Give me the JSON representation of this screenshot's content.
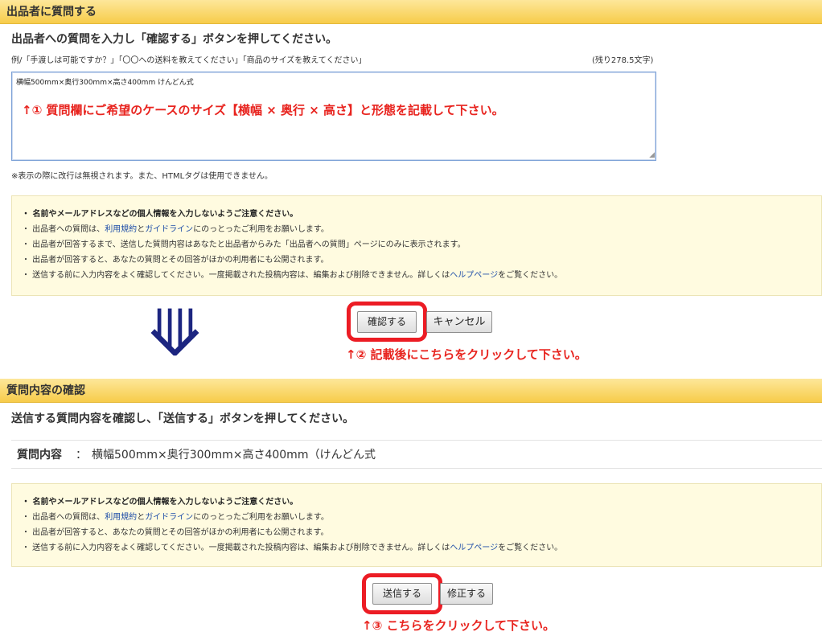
{
  "section1": {
    "header": "出品者に質問する",
    "instruction": "出品者への質問を入力し「確認する」ボタンを押してください。",
    "example": "例/「手渡しは可能ですか？」「〇〇への送料を教えてください」「商品のサイズを教えてください」",
    "remaining": "(残り278.5文字)",
    "textarea_value": "横幅500mm×奥行300mm×高さ400mm  けんどん式",
    "annotation1": "↑① 質問欄にご希望のケースのサイズ【横幅 × 奥行 × 高さ】と形態を記載して下さい。",
    "note": "※表示の際に改行は無視されます。また、HTMLタグは使用できません。",
    "notice": {
      "l1": "・ 名前やメールアドレスなどの個人情報を入力しないようご注意ください。",
      "l2a": "・ 出品者への質問は、",
      "l2_link1": "利用規約",
      "l2b": "と",
      "l2_link2": "ガイドライン",
      "l2c": "にのっとったご利用をお願いします。",
      "l3": "・ 出品者が回答するまで、送信した質問内容はあなたと出品者からみた「出品者への質問」ページにのみに表示されます。",
      "l4": "・ 出品者が回答すると、あなたの質問とその回答がほかの利用者にも公開されます。",
      "l5a": "・ 送信する前に入力内容をよく確認してください。一度掲載された投稿内容は、編集および削除できません。詳しくは",
      "l5_link": "ヘルプページ",
      "l5b": "をご覧ください。"
    },
    "confirm_button": "確認する",
    "cancel_button": "キャンセル",
    "annotation2": "↑② 記載後にこちらをクリックして下さい。"
  },
  "arrow_glyph": "⟱",
  "section2": {
    "header": "質問内容の確認",
    "instruction": "送信する質問内容を確認し、「送信する」ボタンを押してください。",
    "question_label": "質問内容",
    "question_sep": "：",
    "question_value": "横幅500mm×奥行300mm×高さ400mm（けんどん式",
    "notice": {
      "l1": "・ 名前やメールアドレスなどの個人情報を入力しないようご注意ください。",
      "l2a": "・ 出品者への質問は、",
      "l2_link1": "利用規約",
      "l2b": "と",
      "l2_link2": "ガイドライン",
      "l2c": "にのっとったご利用をお願いします。",
      "l3": "・ 出品者が回答すると、あなたの質問とその回答がほかの利用者にも公開されます。",
      "l4a": "・ 送信する前に入力内容をよく確認してください。一度掲載された投稿内容は、編集および削除できません。詳しくは",
      "l4_link": "ヘルプページ",
      "l4b": "をご覧ください。"
    },
    "send_button": "送信する",
    "edit_button": "修正する",
    "annotation3": "↑③ こちらをクリックして下さい。"
  },
  "colors": {
    "header_bg": "#f7cc4a",
    "annotation_red": "#e8241f",
    "ring_red": "#ec1c24",
    "link_blue": "#1f4ea8",
    "notice_bg": "#fffbe0"
  }
}
